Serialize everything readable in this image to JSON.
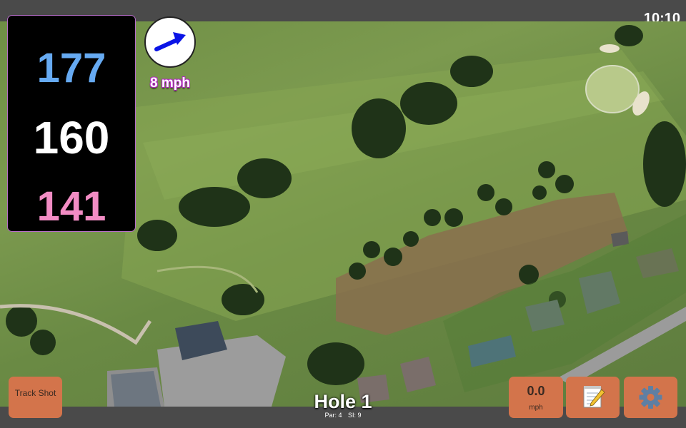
{
  "status": {
    "time": "10:10"
  },
  "distances": {
    "back": "177",
    "middle": "160",
    "front": "141",
    "colors": {
      "back": "#66aaf2",
      "middle": "#ffffff",
      "front": "#f28cc4"
    }
  },
  "wind": {
    "speed_label": "8 mph",
    "arrow_color": "#0a14e6",
    "icon": "wind-direction-arrow"
  },
  "buttons": {
    "track_shot": "Track Shot",
    "speed_value": "0.0",
    "speed_unit": "mph",
    "notes_icon": "notepad-icon",
    "settings_icon": "gear-icon"
  },
  "hole": {
    "title": "Hole 1",
    "par": "Par: 4",
    "si": "SI: 9"
  },
  "colors": {
    "button_bg": "#d3744b",
    "bar_bg": "#4a4a4a",
    "panel_accent": "#b66dc9"
  }
}
